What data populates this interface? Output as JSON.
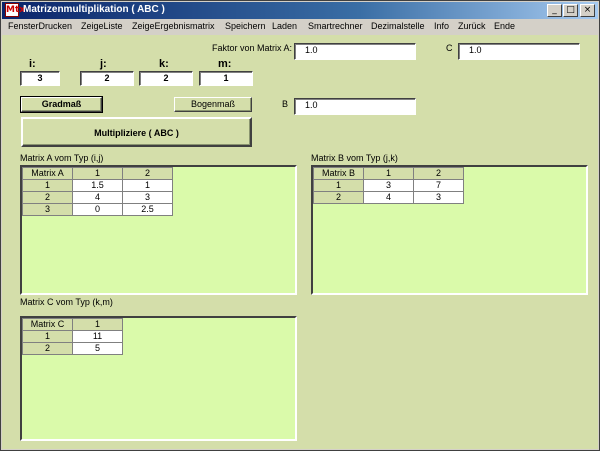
{
  "window": {
    "icon_text": "Mtx",
    "title": "Matrizenmultiplikation ( ABC )",
    "buttons": {
      "minimize": "_",
      "maximize": "□",
      "close": "×"
    }
  },
  "menu": {
    "items": [
      "FensterDrucken",
      "ZeigeListe",
      "ZeigeErgebnismatrix",
      "Speichern",
      "Laden",
      "Smartrechner",
      "Dezimalstelle",
      "Info",
      "Zurück",
      "Ende"
    ]
  },
  "dimensions": [
    {
      "label": "i:",
      "value": "3"
    },
    {
      "label": "j:",
      "value": "2"
    },
    {
      "label": "k:",
      "value": "2"
    },
    {
      "label": "m:",
      "value": "1"
    }
  ],
  "factors": {
    "a_label": "Faktor von Matrix A:",
    "a_value": "1.0",
    "b_label": "B",
    "b_value": "1.0",
    "c_label": "C",
    "c_value": "1.0"
  },
  "buttons": {
    "gradmass": "Gradmaß",
    "bogenmass": "Bogenmaß",
    "multiply": "Multipliziere ( ABC )"
  },
  "matrix_a": {
    "caption": "Matrix A vom Typ (i,j)",
    "header": [
      "Matrix A",
      "1",
      "2"
    ],
    "rows": [
      [
        "1",
        "1.5",
        "1"
      ],
      [
        "2",
        "4",
        "3"
      ],
      [
        "3",
        "0",
        "2.5"
      ]
    ]
  },
  "matrix_b": {
    "caption": "Matrix B vom Typ (j,k)",
    "header": [
      "Matrix B",
      "1",
      "2"
    ],
    "rows": [
      [
        "1",
        "3",
        "7"
      ],
      [
        "2",
        "4",
        "3"
      ]
    ]
  },
  "matrix_c": {
    "caption": "Matrix C vom Typ (k,m)",
    "header": [
      "Matrix C",
      "1"
    ],
    "rows": [
      [
        "1",
        "11"
      ],
      [
        "2",
        "5"
      ]
    ]
  },
  "colors": {
    "client_bg": "#d4deaa",
    "grid_panel_bg": "#dafaaa",
    "title_gradient_start": "#0a246a"
  }
}
